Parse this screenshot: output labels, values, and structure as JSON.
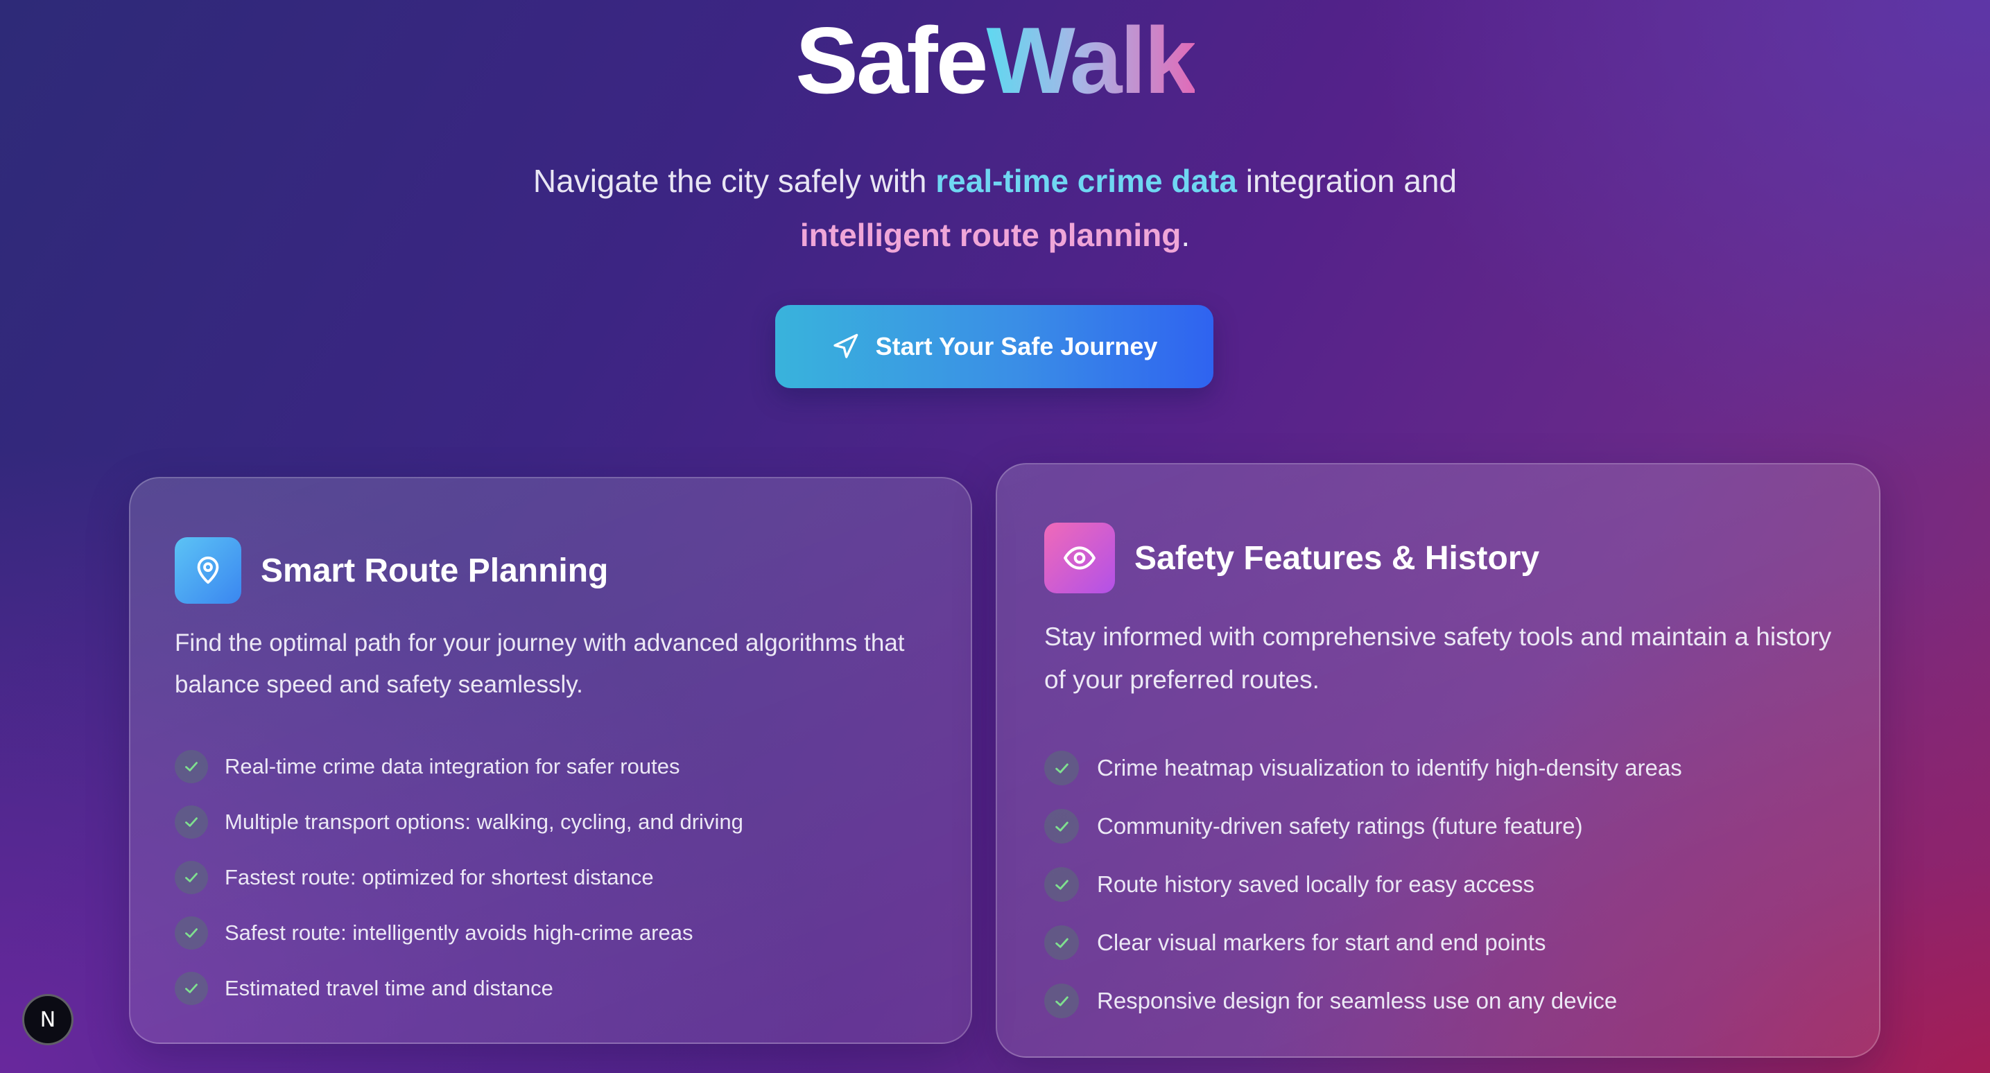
{
  "hero": {
    "title_part1": "Safe",
    "title_part2": "Walk",
    "subtitle_pre": "Navigate the city safely with ",
    "subtitle_highlight1": "real-time crime data",
    "subtitle_mid": " integration and",
    "subtitle_highlight2": "intelligent route planning",
    "subtitle_post": ".",
    "cta_label": "Start Your Safe Journey",
    "cta_icon": "navigation-arrow-icon"
  },
  "cards": [
    {
      "icon": "map-pin-icon",
      "title": "Smart Route Planning",
      "description": "Find the optimal path for your journey with advanced algorithms that balance speed and safety seamlessly.",
      "features": [
        "Real-time crime data integration for safer routes",
        "Multiple transport options: walking, cycling, and driving",
        "Fastest route: optimized for shortest distance",
        "Safest route: intelligently avoids high-crime areas",
        "Estimated travel time and distance"
      ]
    },
    {
      "icon": "eye-icon",
      "title": "Safety Features & History",
      "description": "Stay informed with comprehensive safety tools and maintain a history of your preferred routes.",
      "features": [
        "Crime heatmap visualization to identify high-density areas",
        "Community-driven safety ratings (future feature)",
        "Route history saved locally for easy access",
        "Clear visual markers for start and end points",
        "Responsive design for seamless use on any device"
      ]
    }
  ],
  "dev_badge": {
    "label": "N"
  },
  "colors": {
    "accent_cyan": "#6fd7f2",
    "accent_pink": "#f0a6d8",
    "cta_start": "#39b3dc",
    "cta_end": "#2f63f0",
    "check_green": "#7fe08f"
  }
}
